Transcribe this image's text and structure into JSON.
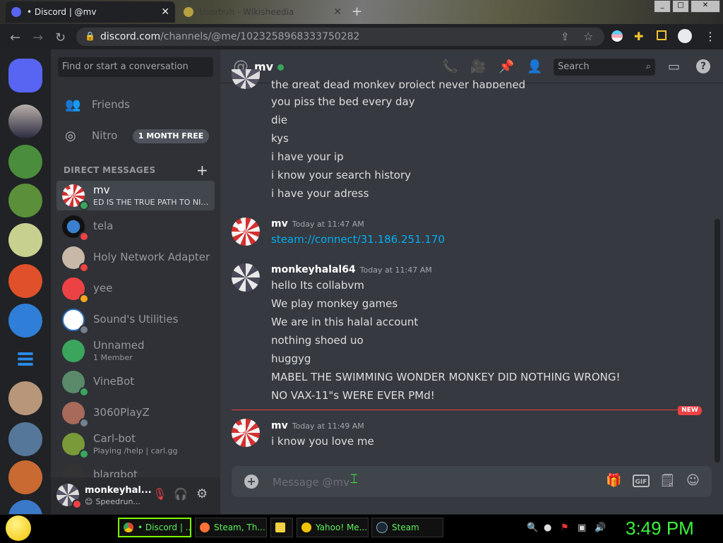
{
  "browser": {
    "tabs": [
      {
        "title": "• Discord | @mv",
        "active": true
      },
      {
        "title": "Userbuh - Wikisheedia",
        "active": false
      }
    ],
    "new_tab": "+",
    "url_host": "discord.com",
    "url_path": "/channels/@me/1023258968333750282"
  },
  "discord": {
    "find_placeholder": "Find or start a conversation",
    "nav": {
      "friends": "Friends",
      "nitro": "Nitro",
      "nitro_badge": "1 MONTH FREE"
    },
    "dm_header": "DIRECT MESSAGES",
    "dms": [
      {
        "name": "mv",
        "sub": "ED IS THE TRUE PATH TO NIR...",
        "status": "#3ba55d"
      },
      {
        "name": "tela",
        "sub": "",
        "status": "#ed4245"
      },
      {
        "name": "Holy Network Adapter",
        "sub": "",
        "status": "#ed4245"
      },
      {
        "name": "yee",
        "sub": "",
        "status": "#faa81a"
      },
      {
        "name": "Sound's Utilities",
        "sub": "",
        "status": "#747f8d"
      },
      {
        "name": "Unnamed",
        "sub": "1 Member",
        "status": ""
      },
      {
        "name": "VineBot",
        "sub": "",
        "status": "#3ba55d"
      },
      {
        "name": "3060PlayZ",
        "sub": "",
        "status": "#747f8d"
      },
      {
        "name": "Carl-bot",
        "sub": "Playing /help | carl.gg",
        "status": "#3ba55d"
      },
      {
        "name": "blargbot",
        "sub": "",
        "status": ""
      }
    ],
    "user": {
      "name": "monkeyhal...",
      "status": "Speedrun..."
    },
    "chat": {
      "title": "mv",
      "search_placeholder": "Search",
      "cut_line": "the great dead monkey project never happened",
      "top_lines": [
        "you piss the bed every day",
        "die",
        "kys",
        "i have your ip",
        "i know your  search history",
        "i have your adress"
      ],
      "msg1": {
        "author": "mv",
        "time": "Today at 11:47 AM",
        "link": "steam://connect/31.186.251.170"
      },
      "msg2": {
        "author": "monkeyhalal64",
        "time": "Today at 11:47 AM",
        "lines": [
          "hello Its collabvm",
          "We play monkey games",
          "We are in this halal account",
          "nothing shoed uo",
          "huggyg",
          "MABEL THE SWIMMING WONDER MONKEY DID NOTHING WRONG!",
          "NO VAX-11\"s WERE EVER PMd!"
        ]
      },
      "new_badge": "NEW",
      "msg3": {
        "author": "mv",
        "time": "Today at 11:49 AM",
        "text": "i know you love me"
      },
      "composer_placeholder": "Message @mv"
    }
  },
  "taskbar": {
    "items": [
      {
        "label": "• Discord | ...",
        "active": true
      },
      {
        "label": "Steam, Th...",
        "active": false
      },
      {
        "label": "",
        "active": false
      },
      {
        "label": "Yahoo! Me...",
        "active": false
      },
      {
        "label": "Steam",
        "active": false
      }
    ],
    "clock": "3:49 PM"
  },
  "colors": {
    "blurple": "#5865f2",
    "green": "#3ba55d",
    "red": "#ed4245",
    "link": "#00aff4"
  }
}
